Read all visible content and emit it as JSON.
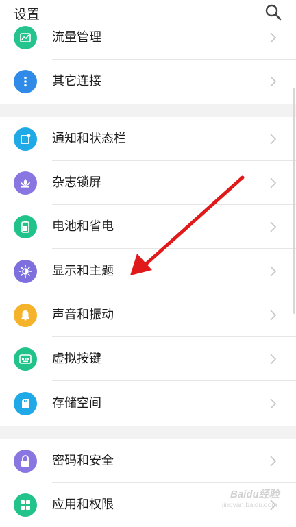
{
  "header": {
    "title": "设置"
  },
  "groups": [
    [
      {
        "label": "流量管理",
        "icon": "chart-icon",
        "color": "#25c38e"
      },
      {
        "label": "其它连接",
        "icon": "more-dots-icon",
        "color": "#2f8ae8"
      }
    ],
    [
      {
        "label": "通知和状态栏",
        "icon": "notification-icon",
        "color": "#1fa9e6"
      },
      {
        "label": "杂志锁屏",
        "icon": "lotus-icon",
        "color": "#8a76e0"
      },
      {
        "label": "电池和省电",
        "icon": "battery-icon",
        "color": "#22c38a"
      },
      {
        "label": "显示和主题",
        "icon": "brightness-icon",
        "color": "#7d6fde"
      },
      {
        "label": "声音和振动",
        "icon": "bell-icon",
        "color": "#f5b32b"
      },
      {
        "label": "虚拟按键",
        "icon": "virtual-keys-icon",
        "color": "#22c38a"
      },
      {
        "label": "存储空间",
        "icon": "sd-card-icon",
        "color": "#1fa9e6"
      }
    ],
    [
      {
        "label": "密码和安全",
        "icon": "lock-icon",
        "color": "#8a76e0"
      },
      {
        "label": "应用和权限",
        "icon": "apps-grid-icon",
        "color": "#22c38a"
      }
    ]
  ],
  "watermark": {
    "text": "Baidu经验",
    "sub": "jingyan.baidu.com"
  },
  "colors": {
    "annotation_arrow": "#e0191b",
    "section_gap": "#f2f2f2"
  }
}
